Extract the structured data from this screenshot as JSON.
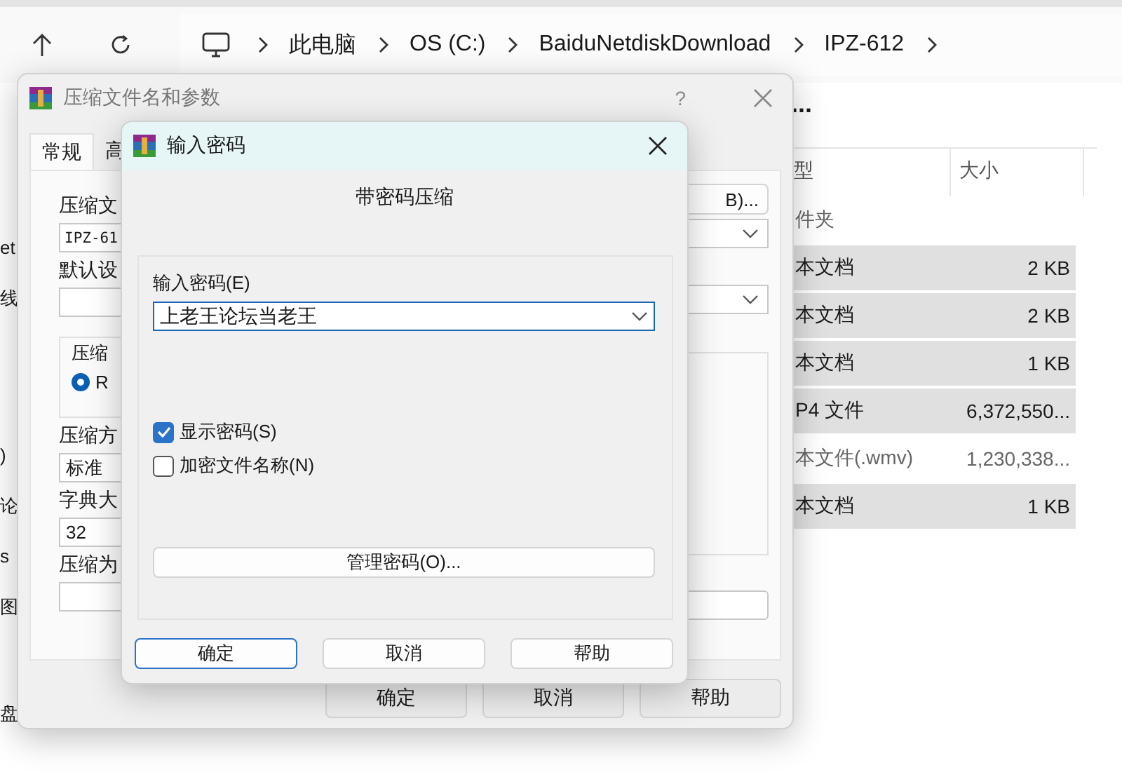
{
  "explorer": {
    "breadcrumbs": [
      "此电脑",
      "OS (C:)",
      "BaiduNetdiskDownload",
      "IPZ-612"
    ],
    "more": "...",
    "columns": [
      "型",
      "大小"
    ],
    "rows": [
      {
        "type": "件夹",
        "selected": false
      },
      {
        "type": "本文档",
        "size": "2 KB",
        "selected": true
      },
      {
        "type": "本文档",
        "size": "2 KB",
        "selected": true
      },
      {
        "type": "本文档",
        "size": "1 KB",
        "selected": true
      },
      {
        "type": "P4 文件",
        "size": "6,372,550...",
        "selected": true
      },
      {
        "type": "本文件(.wmv)",
        "size": "1,230,338...",
        "selected": false
      },
      {
        "type": "本文档",
        "size": "1 KB",
        "selected": true
      }
    ],
    "sidebar_items": [
      "et",
      "线",
      ")",
      "论",
      "s",
      "图",
      "盘"
    ]
  },
  "archive_dialog": {
    "title": "压缩文件名和参数",
    "help": "?",
    "tabs": [
      {
        "label": "常规",
        "selected": true
      },
      {
        "label": "高",
        "selected": false
      }
    ],
    "archive_name_label": "压缩文",
    "archive_name": "IPZ-61",
    "profile_label": "默认设",
    "format_group_label": "压缩",
    "format_radio": {
      "label": "R",
      "selected": true
    },
    "method_label": "压缩方",
    "method": "标准",
    "dict_label": "字典大",
    "dict": "32",
    "split_label": "压缩为",
    "browse_button": "B)...",
    "buttons": [
      "确定",
      "取消",
      "帮助"
    ]
  },
  "password_dialog": {
    "title": "输入密码",
    "heading": "带密码压缩",
    "password_label": "输入密码(E)",
    "password": "上老王论坛当老王",
    "options": [
      {
        "label": "显示密码(S)",
        "checked": true
      },
      {
        "label": "加密文件名称(N)",
        "checked": false
      }
    ],
    "manage_button": "管理密码(O)...",
    "buttons": [
      {
        "label": "确定",
        "default": true
      },
      {
        "label": "取消",
        "default": false
      },
      {
        "label": "帮助",
        "default": false
      }
    ]
  }
}
